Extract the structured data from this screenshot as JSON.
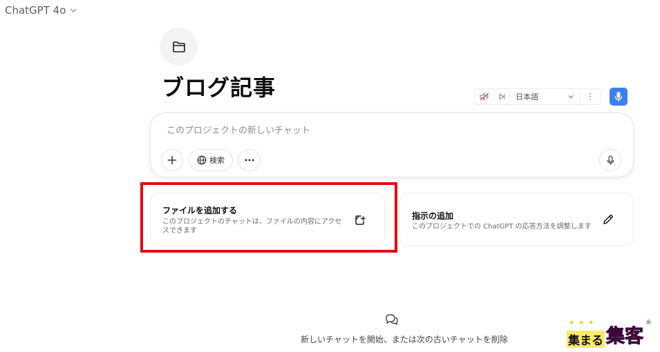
{
  "header": {
    "model_name": "ChatGPT 4o"
  },
  "project": {
    "title": "ブログ記事"
  },
  "voice_toolbar": {
    "language": "日本語",
    "more": "⋮"
  },
  "composer": {
    "placeholder": "このプロジェクトの新しいチャット",
    "search_label": "検索"
  },
  "cards": {
    "files": {
      "title": "ファイルを追加する",
      "description": "このプロジェクトのチャットは、ファイルの内容にアクセスできます"
    },
    "instructions": {
      "title": "指示の追加",
      "description": "このプロジェクトでの ChatGPT の応答方法を調整します"
    }
  },
  "empty_state": {
    "text": "新しいチャットを開始、または次の古いチャットを削除"
  },
  "watermark": {
    "stars": "★★★",
    "part1": "集まる",
    "part2": "集客",
    "reg": "®"
  },
  "colors": {
    "highlight": "#e30613",
    "mic_accent": "#3d7ff0"
  }
}
